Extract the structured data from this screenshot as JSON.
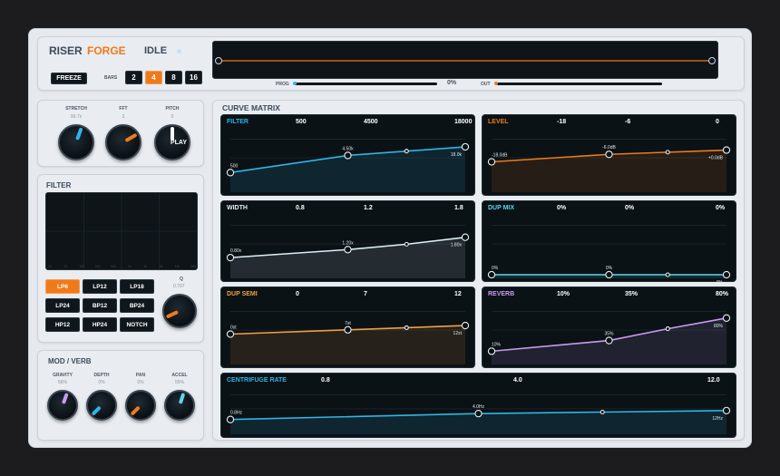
{
  "header": {
    "brand_a": "RISER",
    "brand_b": "FORGE",
    "status": "IDLE",
    "freeze_label": "FREEZE",
    "bars_label": "BARS",
    "bars": [
      "2",
      "4",
      "8",
      "16"
    ],
    "bars_selected": "4",
    "prog_label": "PROG",
    "prog_value": "0%",
    "out_label": "OUT"
  },
  "knobs_top": [
    {
      "label": "STRETCH",
      "value": "99.7x",
      "rotation": 20,
      "color": "#2fb5e6"
    },
    {
      "label": "FFT",
      "value": "3",
      "rotation": 60,
      "color": "#f07a1a"
    },
    {
      "label": "PITCH",
      "value": "0",
      "rotation": 0,
      "color": "#ffffff",
      "center": "PLAY"
    }
  ],
  "filter": {
    "title": "FILTER",
    "axis_ticks": [
      "20",
      "50",
      "100",
      "200",
      "500",
      "1k",
      "2k",
      "5k",
      "10k",
      "20k"
    ],
    "types": [
      "LP6",
      "LP12",
      "LP18",
      "LP24",
      "BP12",
      "BP24",
      "HP12",
      "HP24",
      "NOTCH"
    ],
    "selected": "LP6",
    "q_label": "Q",
    "q_value": "0.707"
  },
  "mod_verb": {
    "title": "MOD / VERB",
    "knobs": [
      {
        "label": "GRAVITY",
        "value": "56%",
        "rotation": 20,
        "color": "#c89bf0"
      },
      {
        "label": "DEPTH",
        "value": "0%",
        "rotation": -135,
        "color": "#2fb5e6"
      },
      {
        "label": "PAN",
        "value": "0%",
        "rotation": -135,
        "color": "#f07a1a"
      },
      {
        "label": "ACCEL",
        "value": "55%",
        "rotation": 18,
        "color": "#5fd4e8"
      }
    ]
  },
  "matrix": {
    "title": "CURVE MATRIX",
    "curves": [
      {
        "name": "FILTER",
        "color": "#2fb5e6",
        "heads": [
          "500",
          "4500",
          "18000"
        ],
        "points": [
          {
            "x": 0,
            "y": 0.3,
            "label": "500"
          },
          {
            "x": 0.5,
            "y": 0.62,
            "label": "4.50k"
          },
          {
            "x": 0.75,
            "y": 0.7,
            "label": ""
          },
          {
            "x": 1,
            "y": 0.78,
            "label": "18.0k"
          }
        ]
      },
      {
        "name": "LEVEL",
        "color": "#f07a1a",
        "heads": [
          "-18",
          "-6",
          "0"
        ],
        "points": [
          {
            "x": 0,
            "y": 0.5,
            "label": "-18.0dB"
          },
          {
            "x": 0.5,
            "y": 0.64,
            "label": "-6.0dB"
          },
          {
            "x": 0.75,
            "y": 0.68,
            "label": ""
          },
          {
            "x": 1,
            "y": 0.72,
            "label": "+0.0dB"
          }
        ]
      },
      {
        "name": "WIDTH",
        "color": "#dceff5",
        "heads": [
          "0.8",
          "1.2",
          "1.8"
        ],
        "points": [
          {
            "x": 0,
            "y": 0.32,
            "label": "0.80x"
          },
          {
            "x": 0.5,
            "y": 0.47,
            "label": "1.20x"
          },
          {
            "x": 0.75,
            "y": 0.57,
            "label": ""
          },
          {
            "x": 1,
            "y": 0.7,
            "label": "1.80x"
          }
        ]
      },
      {
        "name": "DUP MIX",
        "color": "#5fd4e8",
        "heads": [
          "0%",
          "0%",
          "0%"
        ],
        "points": [
          {
            "x": 0,
            "y": 0.0,
            "label": "0%"
          },
          {
            "x": 0.5,
            "y": 0.0,
            "label": "0%"
          },
          {
            "x": 0.75,
            "y": 0.0,
            "label": ""
          },
          {
            "x": 1,
            "y": 0.0,
            "label": "0%"
          }
        ]
      },
      {
        "name": "DUP SEMI",
        "color": "#f0a040",
        "heads": [
          "0",
          "7",
          "12"
        ],
        "points": [
          {
            "x": 0,
            "y": 0.5,
            "label": "0st"
          },
          {
            "x": 0.5,
            "y": 0.58,
            "label": "7st"
          },
          {
            "x": 0.75,
            "y": 0.62,
            "label": ""
          },
          {
            "x": 1,
            "y": 0.66,
            "label": "12st"
          }
        ]
      },
      {
        "name": "REVERB",
        "color": "#c89bf0",
        "heads": [
          "10%",
          "35%",
          "80%"
        ],
        "points": [
          {
            "x": 0,
            "y": 0.18,
            "label": "10%"
          },
          {
            "x": 0.5,
            "y": 0.38,
            "label": "35%"
          },
          {
            "x": 0.75,
            "y": 0.6,
            "label": ""
          },
          {
            "x": 1,
            "y": 0.8,
            "label": "80%"
          }
        ]
      },
      {
        "name": "CENTRIFUGE RATE",
        "color": "#2fb5e6",
        "heads": [
          "0.8",
          "4.0",
          "12.0"
        ],
        "points": [
          {
            "x": 0,
            "y": 0.3,
            "label": "0.8Hz"
          },
          {
            "x": 0.5,
            "y": 0.46,
            "label": "4.0Hz"
          },
          {
            "x": 0.75,
            "y": 0.5,
            "label": ""
          },
          {
            "x": 1,
            "y": 0.54,
            "label": "12Hz"
          }
        ]
      }
    ]
  },
  "colors": {
    "accent": "#f07a1a",
    "panel": "#e9ecf0",
    "screen": "#0b1216"
  }
}
